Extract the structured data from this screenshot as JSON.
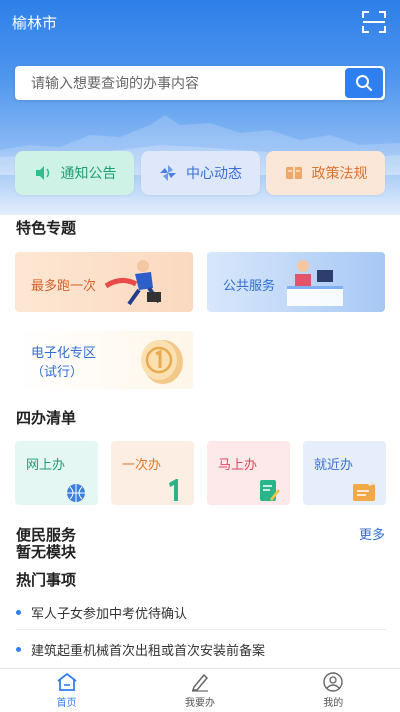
{
  "header": {
    "city": "榆林市"
  },
  "search": {
    "placeholder": "请输入想要查询的办事内容"
  },
  "quick_links": [
    {
      "label": "通知公告",
      "icon": "speaker-icon"
    },
    {
      "label": "中心动态",
      "icon": "pinwheel-icon"
    },
    {
      "label": "政策法规",
      "icon": "book-icon"
    }
  ],
  "featured": {
    "title": "特色专题",
    "cards": [
      {
        "label": "最多跑一次"
      },
      {
        "label": "公共服务"
      },
      {
        "label_line1": "电子化专区",
        "label_line2": "（试行）"
      }
    ]
  },
  "four": {
    "title": "四办清单",
    "items": [
      {
        "label": "网上办"
      },
      {
        "label": "一次办"
      },
      {
        "label": "马上办"
      },
      {
        "label": "就近办"
      }
    ]
  },
  "convenience": {
    "title": "便民服务",
    "more": "更多",
    "empty": "暂无模块"
  },
  "hot": {
    "title": "热门事项",
    "items": [
      "军人子女参加中考优待确认",
      "建筑起重机械首次出租或首次安装前备案"
    ]
  },
  "tabs": [
    {
      "label": "首页",
      "active": true
    },
    {
      "label": "我要办",
      "active": false
    },
    {
      "label": "我的",
      "active": false
    }
  ],
  "colors": {
    "primary": "#2e7ff0",
    "green": "#1f9e74",
    "orange": "#d9742d",
    "red": "#e1485d"
  }
}
